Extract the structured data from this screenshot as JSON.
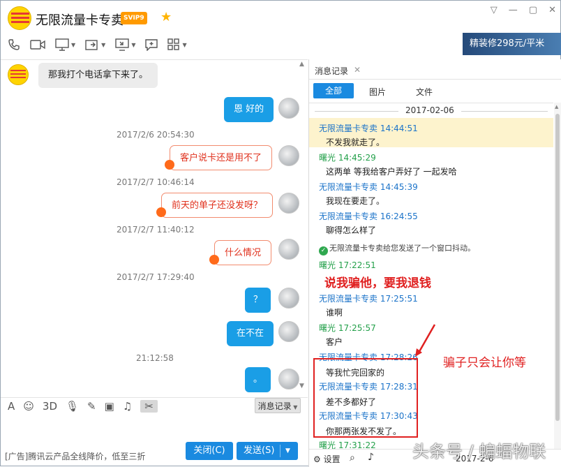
{
  "window": {
    "title": "无限流量卡专卖",
    "badge": "SVIP9",
    "minimize_icon": "minimize-icon",
    "restore_icon": "restore-icon",
    "close_icon": "close-icon"
  },
  "toolbar_ad": "精装修298元/平米",
  "chat": {
    "messages": [
      {
        "side": "left",
        "text": "那我打个电话拿下来了。"
      },
      {
        "side": "right",
        "text": "恩 好的"
      },
      {
        "timestamp": "2017/2/6 20:54:30"
      },
      {
        "side": "right",
        "text": "客户说卡还是用不了"
      },
      {
        "timestamp": "2017/2/7 10:46:14"
      },
      {
        "side": "right",
        "text": "前天的单子还没发呀？"
      },
      {
        "timestamp": "2017/2/7 11:40:12"
      },
      {
        "side": "right",
        "text": "什么情况"
      },
      {
        "timestamp": "2017/2/7 17:29:40"
      },
      {
        "side": "right",
        "text": "？"
      },
      {
        "side": "right",
        "text": "在不在"
      },
      {
        "timestamp": "21:12:58"
      },
      {
        "side": "right",
        "text": "。"
      }
    ]
  },
  "input_toolbar": {
    "history_button": "消息记录"
  },
  "footer": {
    "ad_text": "[广告]腾讯云产品全线降价，低至三折",
    "close_button": "关闭(C)",
    "send_button": "发送(S)"
  },
  "history_panel": {
    "tab_title": "消息记录",
    "filters": [
      "全部",
      "图片",
      "文件"
    ],
    "date": "2017-02-06",
    "entries": [
      {
        "sender": "无限流量卡专卖 14:44:51",
        "text": "不发我就走了。"
      },
      {
        "sender": "曙光 14:45:29",
        "text": "这两单 等我给客户弄好了 一起发哈"
      },
      {
        "sender": "无限流量卡专卖 14:45:39",
        "text": "我现在要走了。"
      },
      {
        "sender": "无限流量卡专卖 16:24:55",
        "text": "聊得怎么样了"
      },
      {
        "system": "无限流量卡专卖给您发送了一个窗口抖动。"
      },
      {
        "sender": "曙光 17:22:51",
        "text": ""
      },
      {
        "sender": "无限流量卡专卖 17:25:51",
        "text": "谁啊"
      },
      {
        "sender": "曙光 17:25:57",
        "text": "客户"
      },
      {
        "sender": "无限流量卡专卖 17:28:26",
        "text": "等我忙完回家的"
      },
      {
        "sender": "无限流量卡专卖 17:28:31",
        "text": "差不多都好了"
      },
      {
        "sender": "无限流量卡专卖 17:30:43",
        "text": "你那两张发不发了。"
      },
      {
        "sender": "曙光 17:31:22",
        "text": ""
      }
    ],
    "annotation_1": "说我骗他，要我退钱",
    "annotation_2": "骗子只会让你等",
    "bottom": {
      "settings": "设置",
      "date": "2017-2-6"
    }
  },
  "watermark": "头条号 / 蝙蝠物联"
}
